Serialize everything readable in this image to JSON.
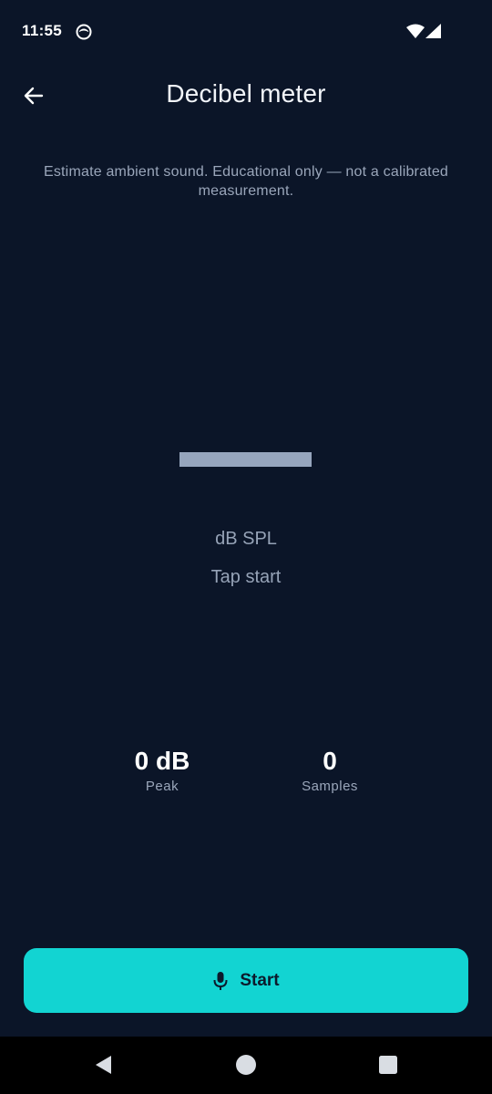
{
  "status_bar": {
    "time": "11:55",
    "app_icon": "notification-face-icon",
    "wifi_icon": "wifi-icon",
    "signal_icon": "cell-signal-icon"
  },
  "header": {
    "back_icon": "arrow-left-icon",
    "title": "Decibel meter"
  },
  "main": {
    "subtitle": "Estimate ambient sound. Educational only — not a calibrated measurement.",
    "unit": "dB SPL",
    "status": "Tap start",
    "stats": [
      {
        "value": "0 dB",
        "label": "Peak"
      },
      {
        "value": "0",
        "label": "Samples"
      }
    ]
  },
  "action": {
    "icon": "microphone-icon",
    "label": "Start"
  },
  "nav": {
    "back_icon": "nav-back-icon",
    "home_icon": "nav-home-icon",
    "recents_icon": "nav-recents-icon"
  },
  "colors": {
    "background": "#0b1528",
    "accent": "#12d4d2",
    "muted_text": "#9aa6ba",
    "level_bar": "#96a5bd"
  }
}
